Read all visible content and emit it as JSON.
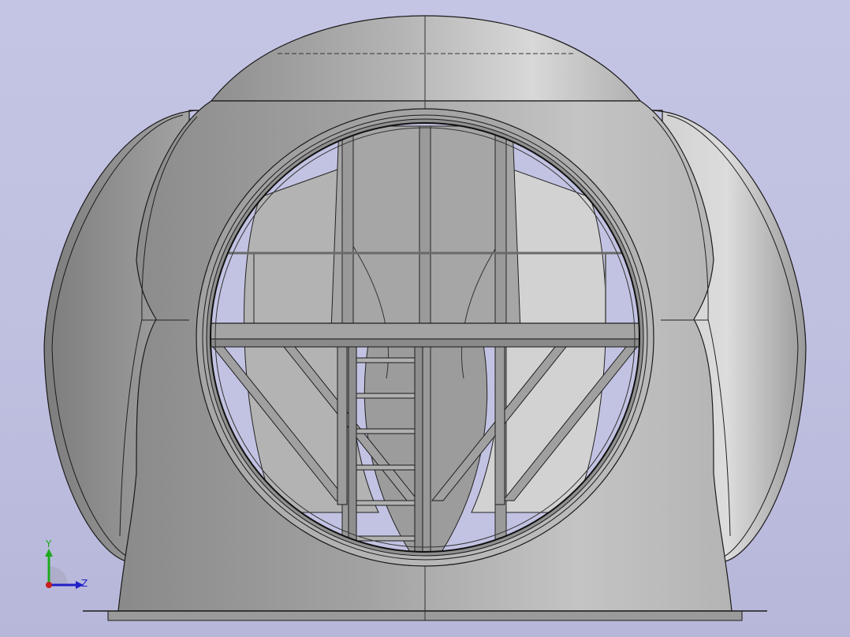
{
  "viewport": {
    "background_top": "#c4c4e4",
    "background_bottom": "#b7b7da"
  },
  "model": {
    "shell_color": "#a9a9a9",
    "edge_color": "#1a1a1a"
  },
  "triad": {
    "y_label": "Y",
    "z_label": "Z",
    "y_color": "#1fa81f",
    "z_color": "#2020c8",
    "origin_color": "#c81e1e"
  }
}
